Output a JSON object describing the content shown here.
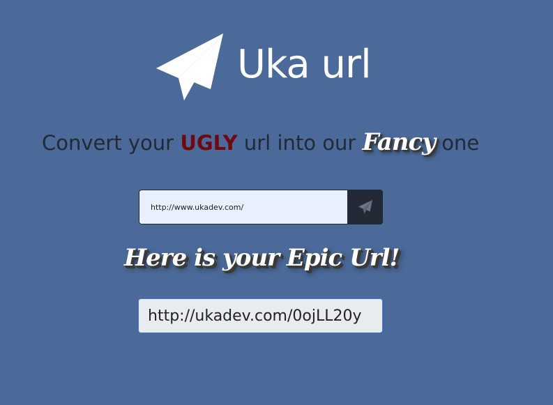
{
  "brand": {
    "logo_icon": "paper-plane-icon",
    "title": "Uka url"
  },
  "tagline": {
    "part1": "Convert your ",
    "ugly": "UGLY",
    "part2": " url into our ",
    "fancy": "Fancy",
    "part3": " one"
  },
  "form": {
    "input_value": "http://www.ukadev.com/",
    "submit_icon": "paper-plane-icon"
  },
  "result": {
    "heading": "Here is your Epic Url!",
    "short_url": "http://ukadev.com/0ojLL20y"
  },
  "colors": {
    "background": "#4b6a99",
    "ugly_accent": "#6e0a0f",
    "button_dark": "#232a35",
    "input_bg": "#e8effd",
    "focus_border": "#3b7bd4"
  }
}
